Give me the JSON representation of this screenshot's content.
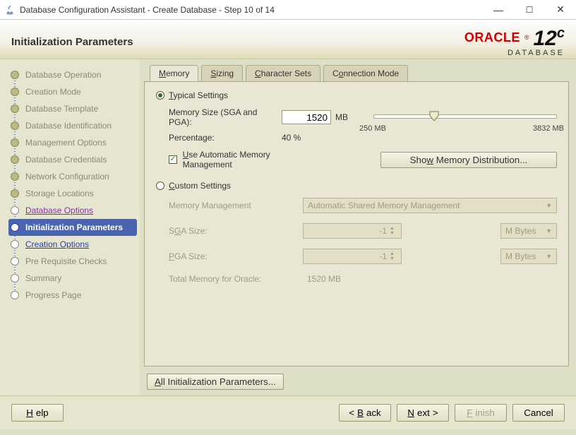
{
  "window": {
    "title": "Database Configuration Assistant - Create Database - Step 10 of 14"
  },
  "header": {
    "page_title": "Initialization Parameters",
    "brand_top": "ORACLE",
    "brand_reg": "®",
    "brand_ver": "12",
    "brand_c": "c",
    "brand_sub": "DATABASE"
  },
  "sidebar": {
    "items": [
      {
        "label": "Database Operation",
        "state": "done"
      },
      {
        "label": "Creation Mode",
        "state": "done"
      },
      {
        "label": "Database Template",
        "state": "done"
      },
      {
        "label": "Database Identification",
        "state": "done"
      },
      {
        "label": "Management Options",
        "state": "done"
      },
      {
        "label": "Database Credentials",
        "state": "done"
      },
      {
        "label": "Network Configuration",
        "state": "done"
      },
      {
        "label": "Storage Locations",
        "state": "done"
      },
      {
        "label": "Database Options",
        "state": "link-m"
      },
      {
        "label": "Initialization Parameters",
        "state": "current"
      },
      {
        "label": "Creation Options",
        "state": "link"
      },
      {
        "label": "Pre Requisite Checks",
        "state": ""
      },
      {
        "label": "Summary",
        "state": ""
      },
      {
        "label": "Progress Page",
        "state": ""
      }
    ]
  },
  "tabs": {
    "memory": "Memory",
    "memory_u": "M",
    "sizing": "Sizing",
    "sizing_u": "S",
    "charsets": "Character Sets",
    "charsets_u": "C",
    "connmode": "Connection Mode",
    "connmode_u": "o"
  },
  "memory_panel": {
    "typical_u": "T",
    "typical_label": "ypical Settings",
    "mem_size_label": "Memory Size (SGA and PGA):",
    "mem_size_value": "1520",
    "mem_size_unit": "MB",
    "percentage_label": "Percentage:",
    "percentage_value": "40 %",
    "slider_min": "250 MB",
    "slider_max": "3832 MB",
    "use_amm_u": "U",
    "use_amm_label": "se Automatic Memory Management",
    "show_dist_u": "w",
    "show_dist_label_pre": "Sho",
    "show_dist_label_post": " Memory Distribution...",
    "custom_u": "C",
    "custom_label": "ustom Settings",
    "mm_label": "Memory Management",
    "mm_value": "Automatic Shared Memory Management",
    "sga_u": "G",
    "sga_label_pre": "S",
    "sga_label_post": "A Size:",
    "sga_value": "-1",
    "pga_u": "P",
    "pga_label_post": "GA Size:",
    "pga_value": "-1",
    "unit_dd": "M Bytes",
    "total_label": "Total Memory for Oracle:",
    "total_value": "1520 MB",
    "all_params_u": "A",
    "all_params_label": "ll Initialization Parameters..."
  },
  "footer": {
    "help": "Help",
    "help_u": "H",
    "back": "Back",
    "back_u": "B",
    "next": "Next",
    "next_u": "N",
    "finish": "Finish",
    "finish_u": "F",
    "cancel": "Cancel"
  }
}
